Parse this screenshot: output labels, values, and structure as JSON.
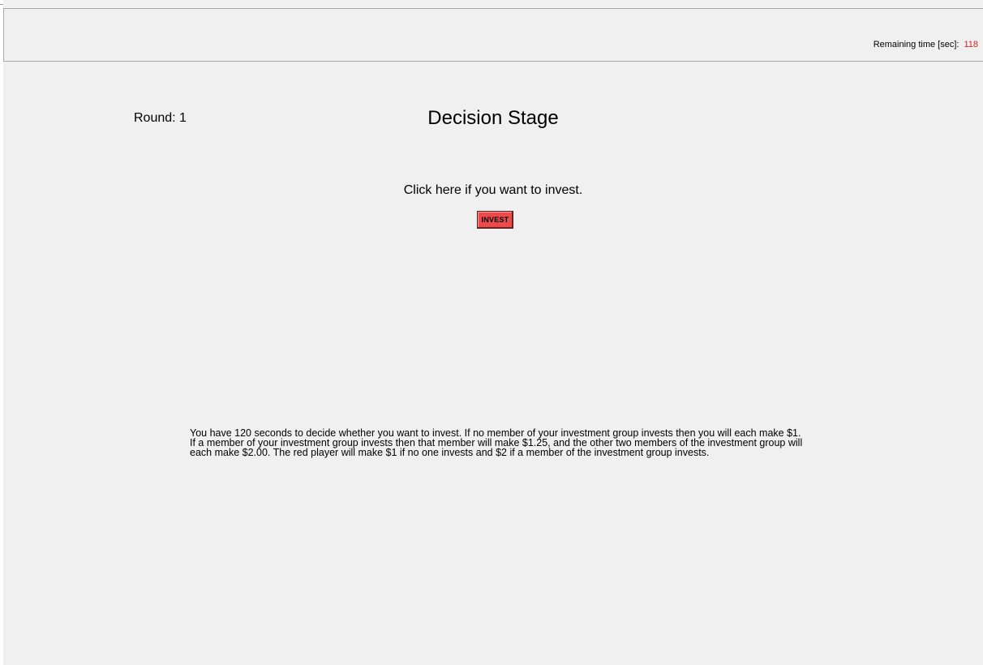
{
  "header": {
    "timer_label": "Remaining time [sec]:",
    "timer_value": "118"
  },
  "main": {
    "round_label": "Round: 1",
    "title": "Decision Stage",
    "prompt": "Click here if you want to invest.",
    "invest_button_label": "INVEST",
    "instructions": "You have 120 seconds to decide whether you want to invest. If no member of your investment group invests then you will each make $1. If a member of your investment group invests then that member will make $1.25, and the other two members of the investment group will each make $2.00. The red player will make $1 if no one invests and $2 if a member of the investment group invests."
  },
  "colors": {
    "background": "#f0f0f0",
    "timer_value": "#e02020",
    "invest_button": "#ec4b4b"
  }
}
